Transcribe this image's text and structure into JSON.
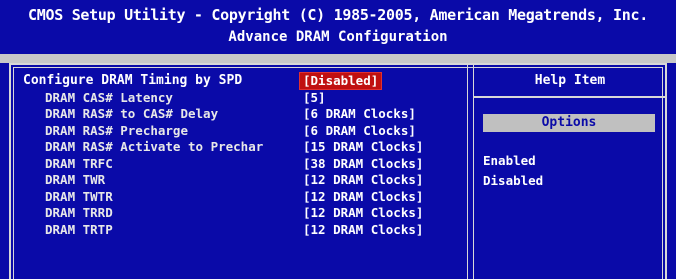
{
  "header": {
    "line1": "CMOS Setup Utility - Copyright (C) 1985-2005, American Megatrends, Inc.",
    "line2": "Advance DRAM Configuration"
  },
  "settings": [
    {
      "label": "Configure DRAM Timing by SPD",
      "value": "[Disabled]"
    },
    {
      "label": "DRAM CAS# Latency",
      "value": "[5]"
    },
    {
      "label": "DRAM RAS# to CAS# Delay",
      "value": "[6 DRAM Clocks]"
    },
    {
      "label": "DRAM RAS# Precharge",
      "value": "[6 DRAM Clocks]"
    },
    {
      "label": "DRAM RAS# Activate to Prechar",
      "value": "[15 DRAM Clocks]"
    },
    {
      "label": "DRAM TRFC",
      "value": "[38 DRAM Clocks]"
    },
    {
      "label": "DRAM TWR",
      "value": "[12 DRAM Clocks]"
    },
    {
      "label": "DRAM TWTR",
      "value": "[12 DRAM Clocks]"
    },
    {
      "label": "DRAM TRRD",
      "value": "[12 DRAM Clocks]"
    },
    {
      "label": "DRAM TRTP",
      "value": "[12 DRAM Clocks]"
    }
  ],
  "help": {
    "title": "Help Item",
    "options_label": "Options",
    "options": [
      "Enabled",
      "Disabled"
    ]
  },
  "colors": {
    "background": "#0a0aa8",
    "selected": "#c01010",
    "band": "#c8c8c8"
  }
}
